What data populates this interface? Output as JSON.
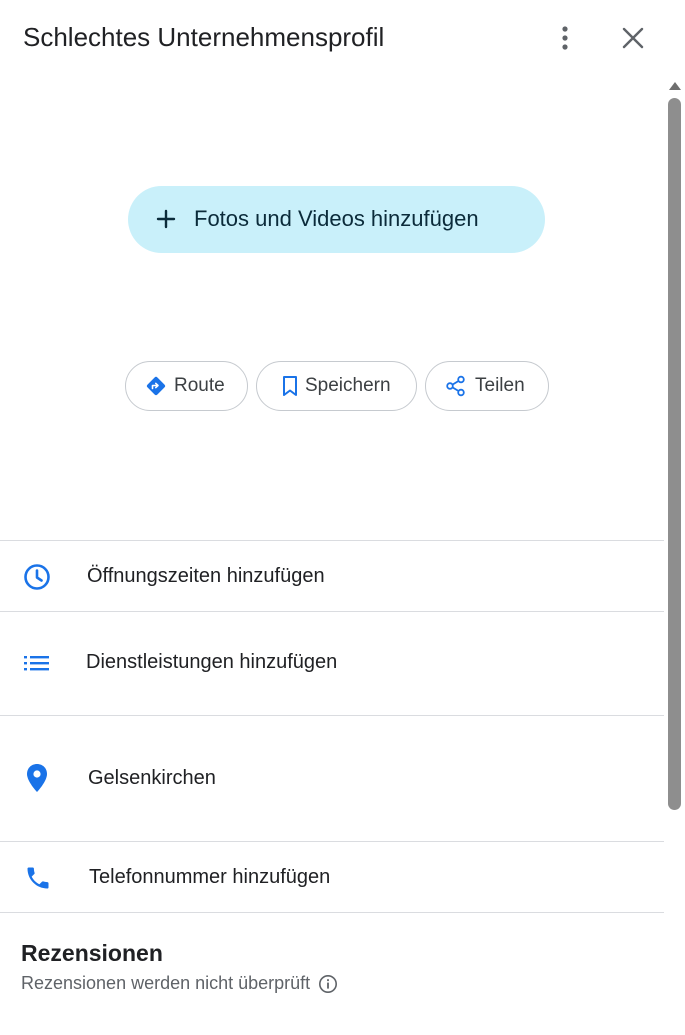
{
  "header": {
    "title": "Schlechtes Unternehmensprofil",
    "more_icon": "more-vert-icon",
    "close_icon": "close-icon"
  },
  "media": {
    "add_label": "Fotos und Videos hinzufügen",
    "icon": "plus-icon"
  },
  "actions": [
    {
      "label": "Route",
      "icon": "directions-icon"
    },
    {
      "label": "Speichern",
      "icon": "bookmark-icon"
    },
    {
      "label": "Teilen",
      "icon": "share-icon"
    }
  ],
  "info_rows": [
    {
      "label": "Öffnungszeiten hinzufügen",
      "icon": "clock-icon"
    },
    {
      "label": "Dienstleistungen hinzufügen",
      "icon": "list-icon"
    },
    {
      "label": "Gelsenkirchen",
      "icon": "location-pin-icon"
    },
    {
      "label": "Telefonnummer hinzufügen",
      "icon": "phone-icon"
    }
  ],
  "reviews": {
    "title": "Rezensionen",
    "subtitle": "Rezensionen werden nicht überprüft",
    "info_icon": "info-icon"
  },
  "colors": {
    "accent_blue": "#1a73e8",
    "add_media_bg": "#c9f0fa",
    "divider": "#dadce0",
    "text_primary": "#202124",
    "text_secondary": "#5f6368"
  }
}
